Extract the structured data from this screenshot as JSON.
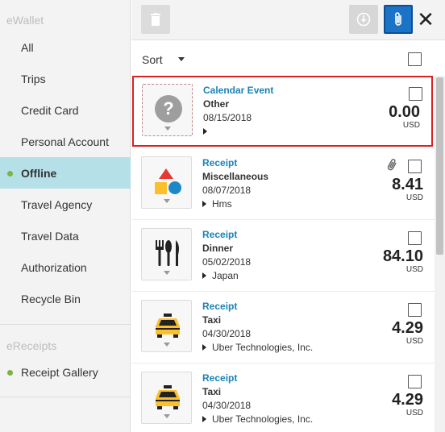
{
  "sidebar": {
    "ewallet_title": "eWallet",
    "items": [
      {
        "label": "All"
      },
      {
        "label": "Trips"
      },
      {
        "label": "Credit Card"
      },
      {
        "label": "Personal Account"
      },
      {
        "label": "Offline",
        "active": true
      },
      {
        "label": "Travel Agency"
      },
      {
        "label": "Travel Data"
      },
      {
        "label": "Authorization"
      },
      {
        "label": "Recycle Bin"
      }
    ],
    "ereceipts_title": "eReceipts",
    "ereceipts_items": [
      {
        "label": "Receipt Gallery"
      }
    ]
  },
  "toolbar": {
    "trash_icon": "trash-icon",
    "add_icon": "download-circle-icon",
    "attach_icon": "paperclip-icon",
    "close_glyph": "✕"
  },
  "sortbar": {
    "sort_label": "Sort"
  },
  "items": [
    {
      "type": "Calendar Event",
      "category": "Other",
      "date": "08/15/2018",
      "vendor": "",
      "amount": "0.00",
      "currency": "USD",
      "icon": "question-icon",
      "selected": true
    },
    {
      "type": "Receipt",
      "category": "Miscellaneous",
      "date": "08/07/2018",
      "vendor": "Hms",
      "amount": "8.41",
      "currency": "USD",
      "icon": "shapes-icon",
      "has_attachment": true
    },
    {
      "type": "Receipt",
      "category": "Dinner",
      "date": "05/02/2018",
      "vendor": "Japan",
      "amount": "84.10",
      "currency": "USD",
      "icon": "fork-knife-icon"
    },
    {
      "type": "Receipt",
      "category": "Taxi",
      "date": "04/30/2018",
      "vendor": "Uber Technologies, Inc.",
      "amount": "4.29",
      "currency": "USD",
      "icon": "taxi-icon"
    },
    {
      "type": "Receipt",
      "category": "Taxi",
      "date": "04/30/2018",
      "vendor": "Uber Technologies, Inc.",
      "amount": "4.29",
      "currency": "USD",
      "icon": "taxi-icon"
    }
  ],
  "colors": {
    "accent": "#1a82b5",
    "active_nav": "#b6e0e8",
    "selection_border": "#e02020",
    "dot": "#7cb342"
  }
}
